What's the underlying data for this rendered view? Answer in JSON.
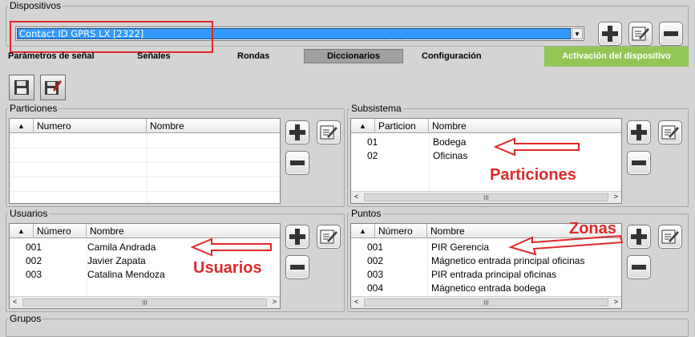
{
  "dispositivos": {
    "legend": "Dispositivos",
    "selected_device": "Contact ID GPRS LX [2322]"
  },
  "tabs": {
    "parametros": "Parámetros de señal",
    "senales": "Señales",
    "rondas": "Rondas",
    "diccionarios": "Diccionarios",
    "configuracion": "Configuración",
    "activacion": "Activación del dispositivo"
  },
  "particiones": {
    "legend": "Particiones",
    "col_numero": "Numero",
    "col_nombre": "Nombre",
    "rows": []
  },
  "subsistema": {
    "legend": "Subsistema",
    "col_particion": "Particion",
    "col_nombre": "Nombre",
    "rows": [
      {
        "num": "01",
        "name": "Bodega"
      },
      {
        "num": "02",
        "name": "Oficinas"
      }
    ]
  },
  "usuarios": {
    "legend": "Usuarios",
    "col_numero": "Número",
    "col_nombre": "Nombre",
    "rows": [
      {
        "num": "001",
        "name": "Camila Andrada"
      },
      {
        "num": "002",
        "name": "Javier Zapata"
      },
      {
        "num": "003",
        "name": "Catalina Mendoza"
      }
    ]
  },
  "puntos": {
    "legend": "Puntos",
    "col_numero": "Número",
    "col_nombre": "Nombre",
    "rows": [
      {
        "num": "001",
        "name": "PIR Gerencia"
      },
      {
        "num": "002",
        "name": "Mágnetico entrada principal oficinas"
      },
      {
        "num": "003",
        "name": "PIR entrada principal oficinas"
      },
      {
        "num": "004",
        "name": "Mágnetico entrada bodega"
      }
    ]
  },
  "grupos": {
    "legend": "Grupos"
  },
  "annotations": {
    "particiones": "Particiones",
    "usuarios": "Usuarios",
    "zonas": "Zonas"
  },
  "colors": {
    "selection": "#3399ff",
    "annotation_red": "#e0282a",
    "activation_green": "#92c756"
  }
}
